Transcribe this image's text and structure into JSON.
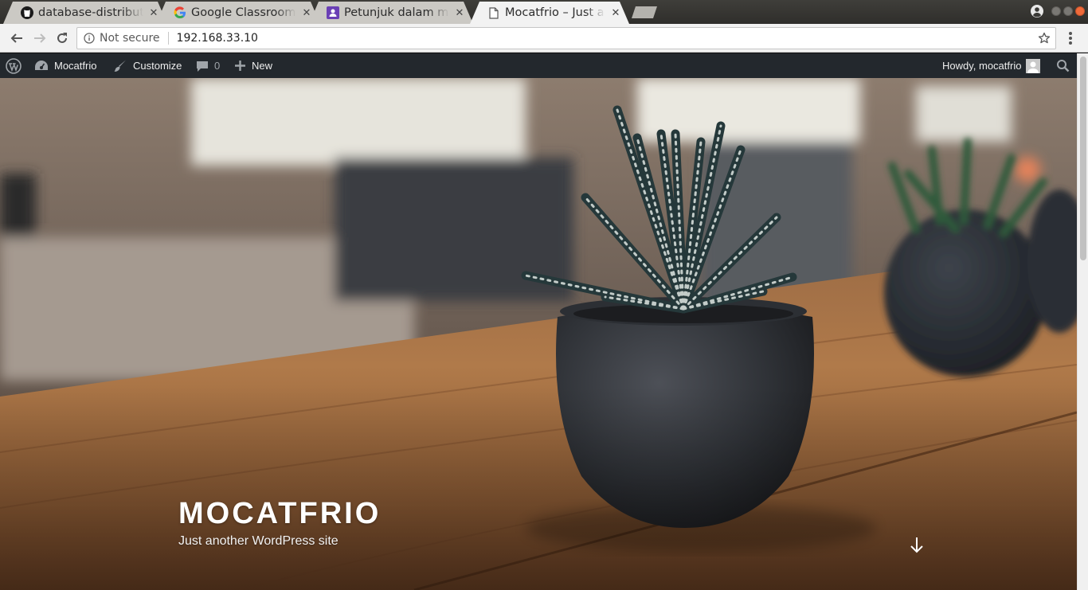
{
  "browser": {
    "tabs": [
      {
        "title": "database-distributed",
        "icon": "github-icon",
        "active": false
      },
      {
        "title": "Google Classroom | Google",
        "icon": "google-icon",
        "active": false
      },
      {
        "title": "Petunjuk dalam menggunakan",
        "icon": "classroom-icon",
        "active": false
      },
      {
        "title": "Mocatfrio – Just another WordPress site",
        "icon": "page-icon",
        "active": true
      }
    ],
    "tab_close_glyph": "✕",
    "address": {
      "security_label": "Not secure",
      "url": "192.168.33.10"
    }
  },
  "admin_bar": {
    "site_name": "Mocatfrio",
    "customize": "Customize",
    "comments_count": "0",
    "new": "New",
    "howdy": "Howdy, mocatfrio"
  },
  "hero": {
    "site_title": "MOCATFRIO",
    "tagline": "Just another WordPress site"
  },
  "colors": {
    "admin_bar_bg": "#23282d",
    "tab_active": "#f2f2f2",
    "tab_inactive": "#cbc9c4",
    "tabstrip": "#3a3936"
  }
}
